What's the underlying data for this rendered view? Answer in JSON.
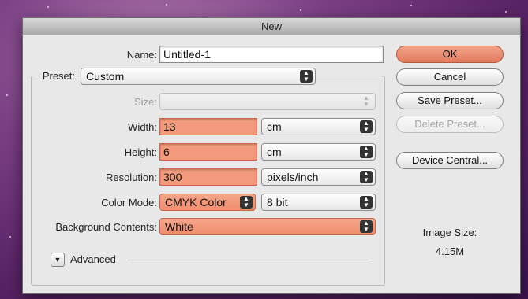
{
  "dialog": {
    "title": "New"
  },
  "form": {
    "name_label": "Name:",
    "name_value": "Untitled-1",
    "preset_label": "Preset:",
    "preset_value": "Custom",
    "size_label": "Size:",
    "size_value": "",
    "width_label": "Width:",
    "width_value": "13",
    "width_unit": "cm",
    "height_label": "Height:",
    "height_value": "6",
    "height_unit": "cm",
    "resolution_label": "Resolution:",
    "resolution_value": "300",
    "resolution_unit": "pixels/inch",
    "color_mode_label": "Color Mode:",
    "color_mode_value": "CMYK Color",
    "bit_depth_value": "8 bit",
    "background_label": "Background Contents:",
    "background_value": "White",
    "advanced_label": "Advanced"
  },
  "buttons": {
    "ok": "OK",
    "cancel": "Cancel",
    "save_preset": "Save Preset...",
    "delete_preset": "Delete Preset...",
    "device_central": "Device Central..."
  },
  "info": {
    "image_size_label": "Image Size:",
    "image_size_value": "4.15M"
  },
  "colors": {
    "highlight": "#f39a7c",
    "dialog_bg": "#e8e8e8",
    "desktop": "#7c3f86"
  },
  "icons": {
    "select_arrows": "up-down-arrows-icon",
    "disclosure": "triangle-down-icon"
  }
}
